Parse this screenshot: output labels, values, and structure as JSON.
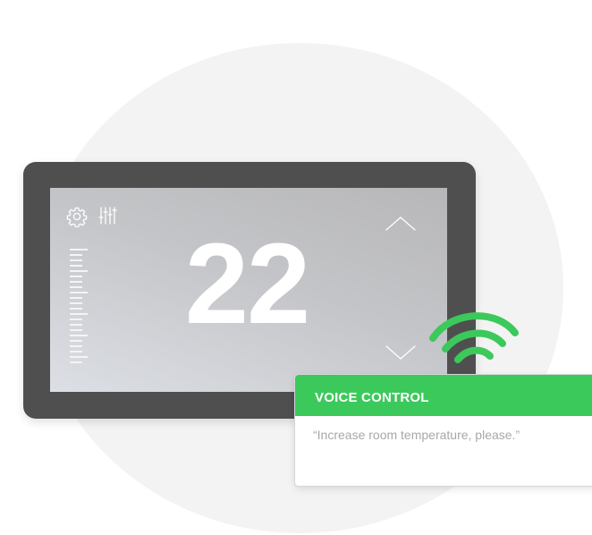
{
  "thermostat": {
    "temperature": "22",
    "icons": [
      "gear-icon",
      "sliders-icon",
      "chevron-up-icon",
      "chevron-down-icon"
    ]
  },
  "voice_control": {
    "title": "VOICE CONTROL",
    "message": "“Increase room temperature, please.”",
    "icon": "wifi-signal-icon"
  },
  "colors": {
    "device": "#4f4f4f",
    "accent": "#3cc95c",
    "background_circle": "#f3f3f3"
  }
}
